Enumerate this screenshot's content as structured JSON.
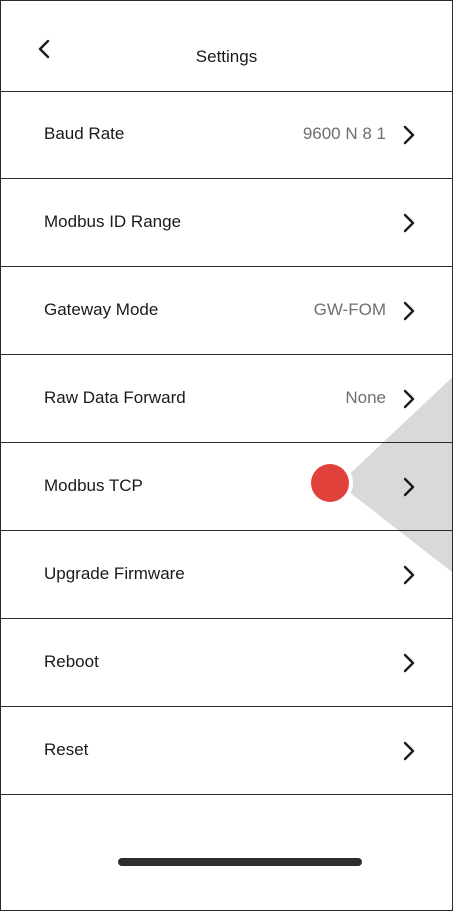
{
  "header": {
    "title": "Settings",
    "back_icon": "chevron-left-icon"
  },
  "rows": [
    {
      "label": "Baud Rate",
      "value": "9600 N 8 1"
    },
    {
      "label": "Modbus ID Range",
      "value": ""
    },
    {
      "label": "Gateway Mode",
      "value": "GW-FOM"
    },
    {
      "label": "Raw Data Forward",
      "value": "None"
    },
    {
      "label": "Modbus TCP",
      "value": ""
    },
    {
      "label": "Upgrade Firmware",
      "value": ""
    },
    {
      "label": "Reboot",
      "value": ""
    },
    {
      "label": "Reset",
      "value": ""
    }
  ],
  "colors": {
    "touch_indicator": "#e0413a",
    "value_text": "#6f6f6f",
    "overlay": "#d9d9d9"
  }
}
